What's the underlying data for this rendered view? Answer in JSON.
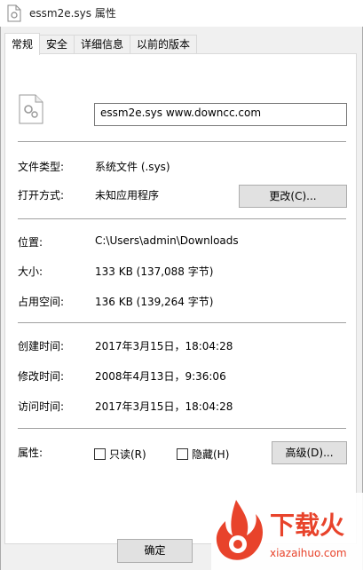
{
  "window": {
    "title": "essm2e.sys 属性"
  },
  "tabs": [
    {
      "label": "常规",
      "active": true
    },
    {
      "label": "安全",
      "active": false
    },
    {
      "label": "详细信息",
      "active": false
    },
    {
      "label": "以前的版本",
      "active": false
    }
  ],
  "general": {
    "name_value": "essm2e.sys    www.downcc.com",
    "type": {
      "label": "文件类型:",
      "value": "系统文件 (.sys)"
    },
    "opens_with": {
      "label": "打开方式:",
      "value": "未知应用程序",
      "button": "更改(C)..."
    },
    "location": {
      "label": "位置:",
      "value": "C:\\Users\\admin\\Downloads"
    },
    "size": {
      "label": "大小:",
      "value": "133 KB (137,088 字节)"
    },
    "size_on_disk": {
      "label": "占用空间:",
      "value": "136 KB (139,264 字节)"
    },
    "created": {
      "label": "创建时间:",
      "value": "2017年3月15日，18:04:28"
    },
    "modified": {
      "label": "修改时间:",
      "value": "2008年4月13日，9:36:06"
    },
    "accessed": {
      "label": "访问时间:",
      "value": "2017年3月15日，18:04:28"
    },
    "attributes": {
      "label": "属性:",
      "readonly": {
        "label": "只读(R)",
        "checked": false
      },
      "hidden": {
        "label": "隐藏(H)",
        "checked": false
      },
      "advanced_button": "高级(D)..."
    }
  },
  "footer": {
    "ok_button": "确定"
  },
  "watermark": {
    "brand": "下载火",
    "domain": "xiazaihuo.com",
    "color": "#e8432b"
  },
  "icons": {
    "title": "system-file-icon",
    "file": "system-file-gear-icon"
  }
}
